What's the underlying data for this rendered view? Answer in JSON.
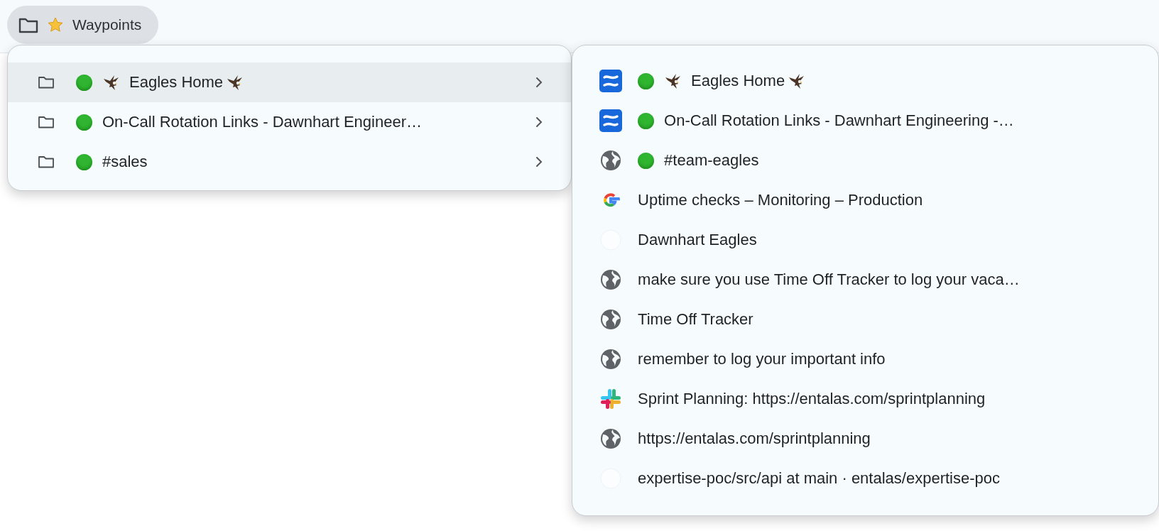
{
  "bookmark_bar": {
    "folder": {
      "label": "Waypoints",
      "starred": true,
      "selected": true
    }
  },
  "folder_menu": {
    "items": [
      {
        "title": "Eagles Home",
        "dot": true,
        "eagles": true,
        "selected": true
      },
      {
        "title": "On-Call Rotation Links - Dawnhart Engineer…",
        "dot": true,
        "eagles": false,
        "selected": false
      },
      {
        "title": "#sales",
        "dot": true,
        "eagles": false,
        "selected": false
      }
    ]
  },
  "submenu": {
    "items": [
      {
        "kind": "confluence",
        "title": "Eagles Home",
        "dot": true,
        "eagles": true
      },
      {
        "kind": "confluence",
        "title": "On-Call Rotation Links - Dawnhart Engineering -…",
        "dot": true,
        "eagles": false
      },
      {
        "kind": "web",
        "title": "#team-eagles",
        "dot": true,
        "eagles": false
      },
      {
        "kind": "google",
        "title": "Uptime checks – Monitoring – Production",
        "dot": false,
        "eagles": false
      },
      {
        "kind": "github",
        "title": "Dawnhart Eagles",
        "dot": false,
        "eagles": false
      },
      {
        "kind": "web",
        "title": "make sure you use Time Off Tracker to log your vaca…",
        "dot": false,
        "eagles": false
      },
      {
        "kind": "web",
        "title": "Time Off Tracker",
        "dot": false,
        "eagles": false
      },
      {
        "kind": "web",
        "title": "remember to log your important info",
        "dot": false,
        "eagles": false
      },
      {
        "kind": "slack",
        "title": "Sprint Planning: https://entalas.com/sprintplanning",
        "dot": false,
        "eagles": false
      },
      {
        "kind": "web",
        "title": "https://entalas.com/sprintplanning",
        "dot": false,
        "eagles": false
      },
      {
        "kind": "github",
        "title": "expertise-poc/src/api at main · entalas/expertise-poc",
        "dot": false,
        "eagles": false
      }
    ]
  }
}
